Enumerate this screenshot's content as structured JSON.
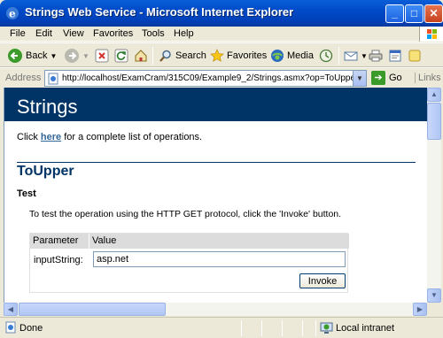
{
  "window": {
    "title": "Strings Web Service - Microsoft Internet Explorer",
    "min_glyph": "_",
    "max_glyph": "□",
    "close_glyph": "✕"
  },
  "menu": [
    "File",
    "Edit",
    "View",
    "Favorites",
    "Tools",
    "Help"
  ],
  "toolbar": {
    "back_label": "Back",
    "search_label": "Search",
    "favorites_label": "Favorites",
    "media_label": "Media"
  },
  "address": {
    "label": "Address",
    "url": "http://localhost/ExamCram/315C09/Example9_2/Strings.asmx?op=ToUpper",
    "go_label": "Go",
    "links_label": "Links"
  },
  "page": {
    "banner_title": "Strings",
    "intro_before": "Click ",
    "intro_link": "here",
    "intro_after": " for a complete list of operations.",
    "operation_title": "ToUpper",
    "test_heading": "Test",
    "test_description": "To test the operation using the HTTP GET protocol, click the 'Invoke' button.",
    "table": {
      "col_parameter": "Parameter",
      "col_value": "Value",
      "param_name": "inputString:",
      "param_value": "asp.net"
    },
    "invoke_label": "Invoke"
  },
  "status": {
    "text": "Done",
    "zone": "Local intranet"
  },
  "colors": {
    "banner": "#003366",
    "link": "#336699",
    "titlebar": "#0049c8"
  }
}
